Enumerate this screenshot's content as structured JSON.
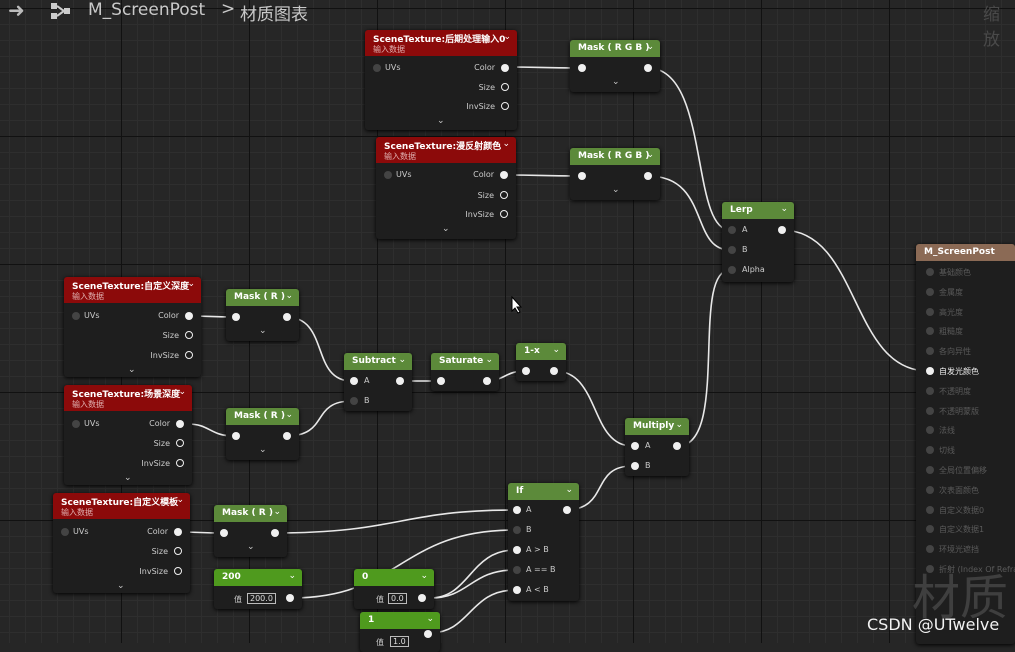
{
  "header": {
    "asset_name": "M_ScreenPost",
    "separator": ">",
    "view_name": "材质图表",
    "zoom_label": "缩放"
  },
  "watermark": {
    "big": "材质",
    "credit": "CSDN @UTwelve"
  },
  "scene_common": {
    "subtitle": "输入数据",
    "uvs": "UVs",
    "color": "Color",
    "size": "Size",
    "invsize": "InvSize"
  },
  "nodes": {
    "st_post": {
      "title": "SceneTexture:后期处理输入0"
    },
    "st_diffuse": {
      "title": "SceneTexture:漫反射颜色"
    },
    "st_depth": {
      "title": "SceneTexture:自定义深度"
    },
    "st_scene": {
      "title": "SceneTexture:场景深度"
    },
    "st_stencil": {
      "title": "SceneTexture:自定义模板"
    },
    "mask_rgb": {
      "title": "Mask ( R G B )"
    },
    "mask_r": {
      "title": "Mask ( R )"
    },
    "subtract": {
      "title": "Subtract",
      "a": "A",
      "b": "B"
    },
    "saturate": {
      "title": "Saturate"
    },
    "one_minus": {
      "title": "1-x"
    },
    "multiply": {
      "title": "Multiply",
      "a": "A",
      "b": "B"
    },
    "lerp": {
      "title": "Lerp",
      "a": "A",
      "b": "B",
      "alpha": "Alpha"
    },
    "if": {
      "title": "If",
      "a": "A",
      "b": "B",
      "agb": "A > B",
      "aeb": "A == B",
      "alb": "A < B"
    },
    "c200": {
      "title": "200",
      "label": "值",
      "value": "200.0"
    },
    "c0": {
      "title": "0",
      "label": "值",
      "value": "0.0"
    },
    "c1": {
      "title": "1",
      "label": "值",
      "value": "1.0"
    }
  },
  "result": {
    "title": "M_ScreenPost",
    "pins": [
      "基础颜色",
      "金属度",
      "高光度",
      "粗糙度",
      "各向异性",
      "自发光颜色",
      "不透明度",
      "不透明蒙版",
      "法线",
      "切线",
      "全局位置偏移",
      "次表面颜色",
      "自定义数据0",
      "自定义数据1",
      "环境光遮挡",
      "折射 (Index Of Refraction)"
    ]
  },
  "colors": {
    "scene_header": "#8c0a0a",
    "math_header": "#5c8a3a",
    "const_header": "#4f9a1e",
    "result_header": "#8b6a55"
  }
}
